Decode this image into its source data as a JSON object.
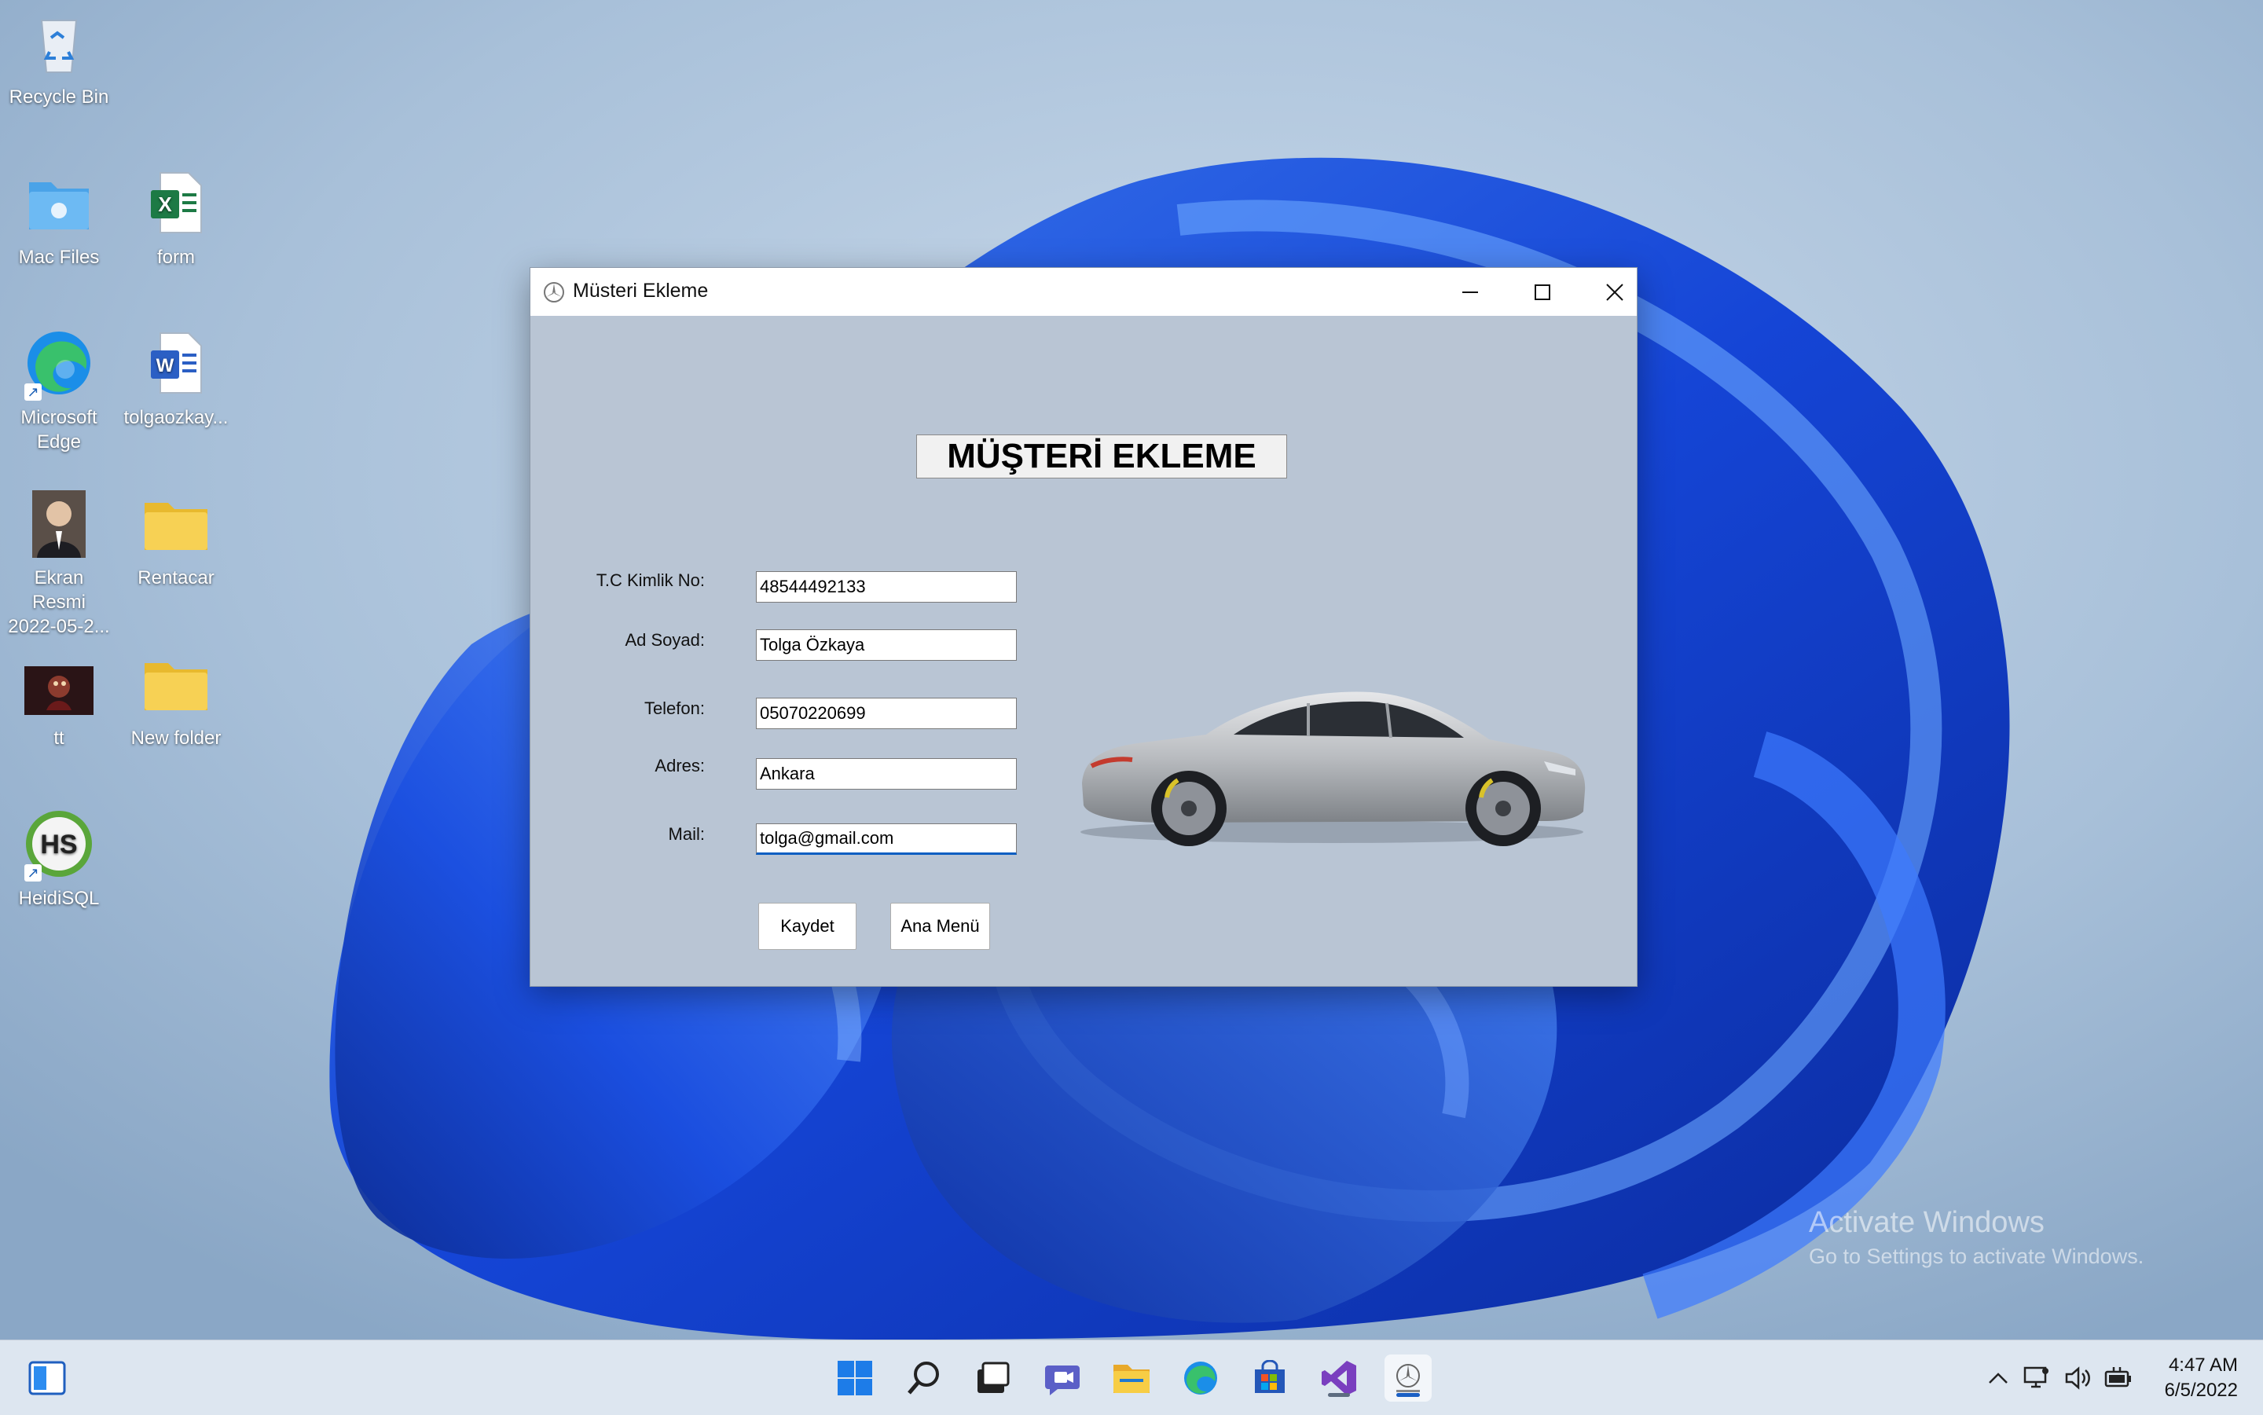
{
  "desktop": {
    "icons": [
      {
        "label": "Recycle Bin"
      },
      {
        "label": "Mac Files"
      },
      {
        "label": "form"
      },
      {
        "label": "Microsoft Edge"
      },
      {
        "label": "tolgaozkay..."
      },
      {
        "label": "Ekran Resmi 2022-05-2..."
      },
      {
        "label": "Rentacar"
      },
      {
        "label": "tt"
      },
      {
        "label": "New folder"
      },
      {
        "label": "HeidiSQL"
      }
    ]
  },
  "window": {
    "title": "Müsteri Ekleme",
    "heading": "MÜŞTERİ EKLEME",
    "fields": [
      {
        "label": "T.C Kimlik No:",
        "value": "48544492133"
      },
      {
        "label": "Ad Soyad:",
        "value": "Tolga Özkaya"
      },
      {
        "label": "Telefon:",
        "value": "05070220699"
      },
      {
        "label": "Adres:",
        "value": "Ankara"
      },
      {
        "label": "Mail:",
        "value": "tolga@gmail.com"
      }
    ],
    "buttons": {
      "save": "Kaydet",
      "main_menu": "Ana Menü"
    }
  },
  "watermark": {
    "line1": "Activate Windows",
    "line2": "Go to Settings to activate Windows."
  },
  "taskbar": {
    "apps": [
      "widgets-icon",
      "start-icon",
      "search-icon",
      "task-view-icon",
      "chat-icon",
      "file-explorer-icon",
      "edge-icon",
      "store-icon",
      "visual-studio-icon",
      "rentacar-app-icon"
    ],
    "clock": {
      "time": "4:47 AM",
      "date": "6/5/2022"
    }
  },
  "colors": {
    "window_client": "#b9c5d4",
    "focus_accent": "#0a5ec2",
    "taskbar": "#dde6f0"
  }
}
